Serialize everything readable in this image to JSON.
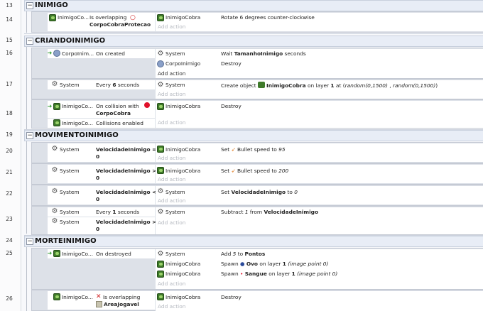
{
  "line_numbers": [
    "13",
    "14",
    "15",
    "16",
    "17",
    "18",
    "19",
    "20",
    "21",
    "22",
    "23",
    "24",
    "25",
    "26"
  ],
  "groups": {
    "inimigo": "INIMIGO",
    "criando": "CRIANDOINIMIGO",
    "movimento": "MOVIMENTOINIMIGO",
    "morte": "MORTEINIMIGO"
  },
  "collapse_symbol": "−",
  "add_action": "Add action",
  "rows": {
    "r14": {
      "obj": "InimigoCo...",
      "cond": "Is overlapping",
      "cond2": "CorpoCobraProtecao",
      "aobj": "InimigoCobra",
      "action": "Rotate 6 degrees counter-clockwise"
    },
    "r16": {
      "obj": "CorpoInim...",
      "cond": "On created",
      "a1obj": "System",
      "a1": {
        "p1": "Wait ",
        "b1": "TamanhoInimigo",
        "p2": " seconds"
      },
      "a2obj": "CorpoInimigo",
      "a2": "Destroy"
    },
    "r17": {
      "obj": "System",
      "cond": {
        "p1": "Every ",
        "b1": "6",
        "p2": " seconds"
      },
      "aobj": "System",
      "action": {
        "p1": "Create object ",
        "b1": "InimigoCobra",
        "p2": " on layer ",
        "b2": "1",
        "p3": " at (",
        "i1": "random(0,1500)",
        "p4": " , ",
        "i2": "random(0,1500)",
        "p5": ")"
      }
    },
    "r18": {
      "obj": "InimigoCo...",
      "cond": "On collision with",
      "cond2": "CorpoCobra",
      "obj2": "InimigoCo...",
      "cond_b": "Collisions enabled",
      "aobj": "InimigoCobra",
      "action": "Destroy"
    },
    "r20": {
      "obj": "System",
      "cond": "VelocidadeInimigo =",
      "cond2": "0",
      "aobj": "InimigoCobra",
      "action": {
        "p1": "Set ",
        "p2": " Bullet speed to ",
        "i1": "95"
      }
    },
    "r21": {
      "obj": "System",
      "cond": "VelocidadeInimigo >",
      "cond2": "0",
      "aobj": "InimigoCobra",
      "action": {
        "p1": "Set ",
        "p2": " Bullet speed to ",
        "i1": "200"
      }
    },
    "r22": {
      "obj": "System",
      "cond": "VelocidadeInimigo <",
      "cond2": "0",
      "aobj": "System",
      "action": {
        "p1": "Set ",
        "b1": "VelocidadeInimigo",
        "p2": " to ",
        "i1": "0"
      }
    },
    "r23": {
      "obj": "System",
      "cond": {
        "p1": "Every ",
        "b1": "1",
        "p2": " seconds"
      },
      "obj2": "System",
      "cond_b": "VelocidadeInimigo >",
      "cond_b2": "0",
      "aobj": "System",
      "action": {
        "p1": "Subtract ",
        "i1": "1",
        "p2": " from ",
        "b1": "VelocidadeInimigo"
      }
    },
    "r25": {
      "obj": "InimigoCo...",
      "cond": "On destroyed",
      "a1obj": "System",
      "a1": {
        "p1": "Add ",
        "i1": "5",
        "p2": " to ",
        "b1": "Pontos"
      },
      "a2obj": "InimigoCobra",
      "a2": {
        "p1": "Spawn ",
        "b1": "Ovo",
        "p2": " on layer ",
        "b2": "1",
        "i1": " (image point 0)"
      },
      "a3obj": "InimigoCobra",
      "a3": {
        "p1": "Spawn ",
        "b1": "Sangue",
        "p2": " on layer ",
        "b2": "1",
        "i1": " (image point 0)"
      }
    },
    "r26": {
      "obj": "InimigoCo...",
      "cond": "Is overlapping",
      "cond2": "AreaJogavel",
      "aobj": "InimigoCobra",
      "action": "Destroy"
    }
  },
  "colors": {
    "group_bg": "#e8edf6",
    "event_bg": "#dde1e8",
    "add_action": "#b5b9c0",
    "trigger": "#2f9a2f",
    "invert": "#d02020"
  }
}
